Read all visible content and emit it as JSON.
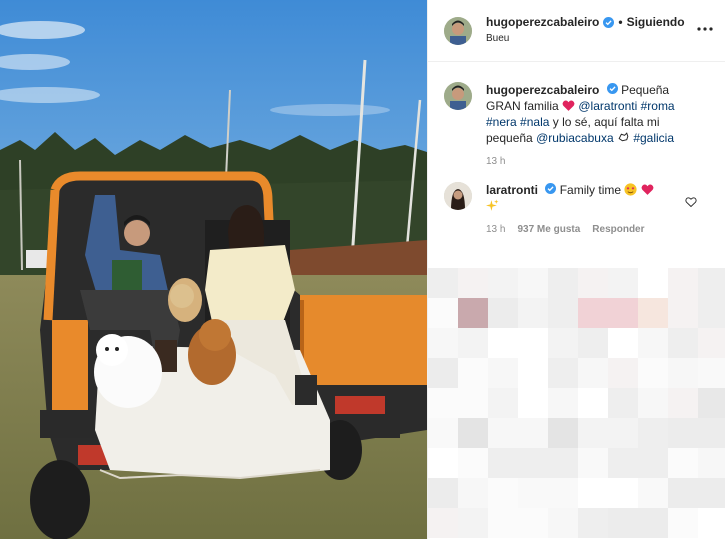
{
  "post": {
    "author": "hugoperezcabaleiro",
    "follow_label": "Siguiendo",
    "location": "Bueu",
    "caption_text": "Pequeña GRAN familia",
    "caption_tags": [
      "@laratronti",
      "#roma",
      "#nera",
      "#nala"
    ],
    "caption_mid": "y lo sé, aquí falta mi pequeña",
    "caption_tag_rubia": "@rubiacabuxa",
    "caption_tag_galicia": "#galicia",
    "caption_time": "13 h"
  },
  "comments": [
    {
      "author": "laratronti",
      "text": "Family time",
      "time": "13 h",
      "likes": "937 Me gusta",
      "reply": "Responder"
    }
  ],
  "colors": {
    "verified": "#3897f0",
    "tag": "#00376b",
    "muted": "#8e8e8e",
    "jeep_orange": "#e98a2b"
  },
  "icons": [
    "verified-badge-icon",
    "more-options-icon",
    "heart-outline-icon"
  ]
}
